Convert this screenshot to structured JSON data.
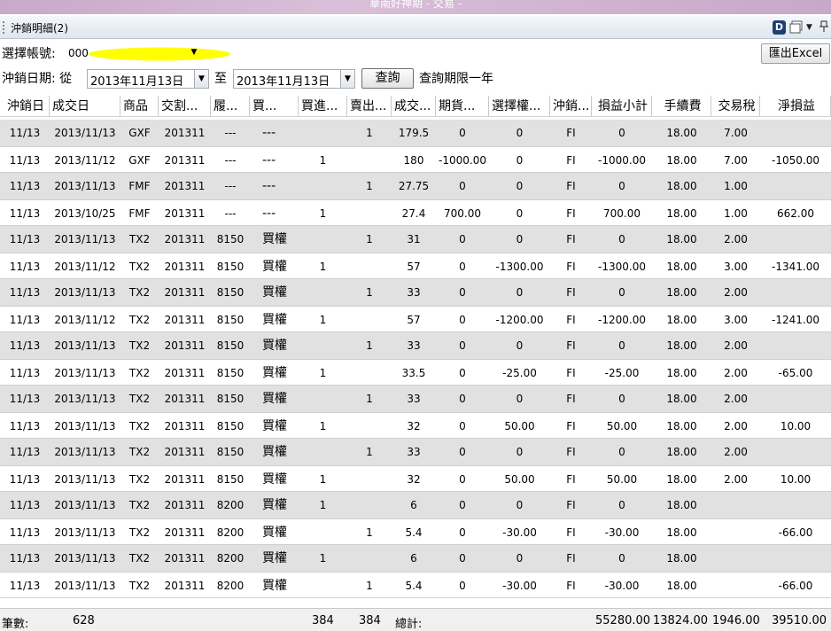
{
  "window": {
    "title": "華南好神期 - 交易 -"
  },
  "panel": {
    "title": "沖銷明細(2)",
    "icon_letter": "D"
  },
  "account": {
    "label": "選擇帳號:",
    "value": "000-"
  },
  "export_button": "匯出Excel",
  "date_filter": {
    "label": "沖銷日期: 從",
    "from": "2013年11月13日",
    "to_label": "至",
    "to": "2013年11月13日",
    "query_button": "查詢",
    "note": "查詢期限一年"
  },
  "table": {
    "columns": [
      "沖銷日",
      "成交日",
      "商品",
      "交割...",
      "履...",
      "買...",
      "買進...",
      "賣出...",
      "成交...",
      "期貨...",
      "選擇權...",
      "沖銷...",
      "損益小計",
      "手續費",
      "交易稅",
      "淨損益"
    ],
    "rows": [
      [
        "11/13",
        "2013/11/13",
        "GXF",
        "201311",
        "---",
        "---",
        "",
        "1",
        "179.5",
        "0",
        "0",
        "FI",
        "0",
        "18.00",
        "7.00",
        ""
      ],
      [
        "11/13",
        "2013/11/12",
        "GXF",
        "201311",
        "---",
        "---",
        "1",
        "",
        "180",
        "-1000.00",
        "0",
        "FI",
        "-1000.00",
        "18.00",
        "7.00",
        "-1050.00"
      ],
      [
        "11/13",
        "2013/11/13",
        "FMF",
        "201311",
        "---",
        "---",
        "",
        "1",
        "27.75",
        "0",
        "0",
        "FI",
        "0",
        "18.00",
        "1.00",
        ""
      ],
      [
        "11/13",
        "2013/10/25",
        "FMF",
        "201311",
        "---",
        "---",
        "1",
        "",
        "27.4",
        "700.00",
        "0",
        "FI",
        "700.00",
        "18.00",
        "1.00",
        "662.00"
      ],
      [
        "11/13",
        "2013/11/13",
        "TX2",
        "201311",
        "8150",
        "買權",
        "",
        "1",
        "31",
        "0",
        "0",
        "FI",
        "0",
        "18.00",
        "2.00",
        ""
      ],
      [
        "11/13",
        "2013/11/12",
        "TX2",
        "201311",
        "8150",
        "買權",
        "1",
        "",
        "57",
        "0",
        "-1300.00",
        "FI",
        "-1300.00",
        "18.00",
        "3.00",
        "-1341.00"
      ],
      [
        "11/13",
        "2013/11/13",
        "TX2",
        "201311",
        "8150",
        "買權",
        "",
        "1",
        "33",
        "0",
        "0",
        "FI",
        "0",
        "18.00",
        "2.00",
        ""
      ],
      [
        "11/13",
        "2013/11/12",
        "TX2",
        "201311",
        "8150",
        "買權",
        "1",
        "",
        "57",
        "0",
        "-1200.00",
        "FI",
        "-1200.00",
        "18.00",
        "3.00",
        "-1241.00"
      ],
      [
        "11/13",
        "2013/11/13",
        "TX2",
        "201311",
        "8150",
        "買權",
        "",
        "1",
        "33",
        "0",
        "0",
        "FI",
        "0",
        "18.00",
        "2.00",
        ""
      ],
      [
        "11/13",
        "2013/11/13",
        "TX2",
        "201311",
        "8150",
        "買權",
        "1",
        "",
        "33.5",
        "0",
        "-25.00",
        "FI",
        "-25.00",
        "18.00",
        "2.00",
        "-65.00"
      ],
      [
        "11/13",
        "2013/11/13",
        "TX2",
        "201311",
        "8150",
        "買權",
        "",
        "1",
        "33",
        "0",
        "0",
        "FI",
        "0",
        "18.00",
        "2.00",
        ""
      ],
      [
        "11/13",
        "2013/11/13",
        "TX2",
        "201311",
        "8150",
        "買權",
        "1",
        "",
        "32",
        "0",
        "50.00",
        "FI",
        "50.00",
        "18.00",
        "2.00",
        "10.00"
      ],
      [
        "11/13",
        "2013/11/13",
        "TX2",
        "201311",
        "8150",
        "買權",
        "",
        "1",
        "33",
        "0",
        "0",
        "FI",
        "0",
        "18.00",
        "2.00",
        ""
      ],
      [
        "11/13",
        "2013/11/13",
        "TX2",
        "201311",
        "8150",
        "買權",
        "1",
        "",
        "32",
        "0",
        "50.00",
        "FI",
        "50.00",
        "18.00",
        "2.00",
        "10.00"
      ],
      [
        "11/13",
        "2013/11/13",
        "TX2",
        "201311",
        "8200",
        "買權",
        "1",
        "",
        "6",
        "0",
        "0",
        "FI",
        "0",
        "18.00",
        "",
        ""
      ],
      [
        "11/13",
        "2013/11/13",
        "TX2",
        "201311",
        "8200",
        "買權",
        "",
        "1",
        "5.4",
        "0",
        "-30.00",
        "FI",
        "-30.00",
        "18.00",
        "",
        "-66.00"
      ],
      [
        "11/13",
        "2013/11/13",
        "TX2",
        "201311",
        "8200",
        "買權",
        "1",
        "",
        "6",
        "0",
        "0",
        "FI",
        "0",
        "18.00",
        "",
        ""
      ],
      [
        "11/13",
        "2013/11/13",
        "TX2",
        "201311",
        "8200",
        "買權",
        "",
        "1",
        "5.4",
        "0",
        "-30.00",
        "FI",
        "-30.00",
        "18.00",
        "",
        "-66.00"
      ]
    ]
  },
  "footer": {
    "count_label": "筆數:",
    "count": "628",
    "buy_total": "384",
    "sell_total": "384",
    "total_label": "總計:",
    "pnl_total": "55280.00",
    "fee_total": "13824.00",
    "tax_total": "1946.00",
    "net_total": "39510.00"
  },
  "colors": {
    "odd_row": "#e1e1e1",
    "even_row": "#ffffff",
    "account_mask": "#ffff00"
  }
}
